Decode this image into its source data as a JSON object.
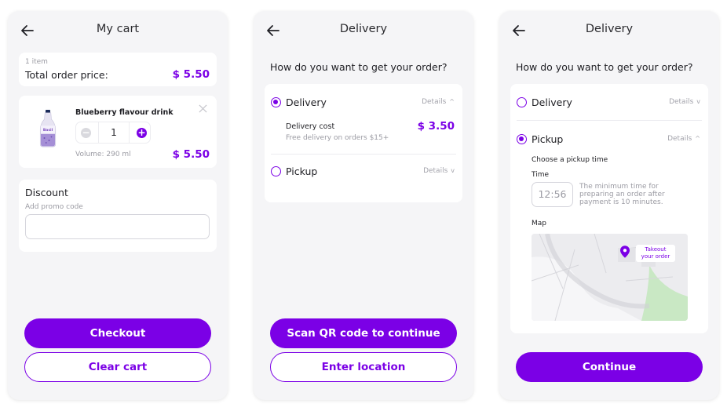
{
  "cart": {
    "title": "My cart",
    "items_count": "1 item",
    "total_label": "Total order price:",
    "total_value": "$ 5.50",
    "product": {
      "name": "Blueberry flavour drink",
      "quantity": "1",
      "volume": "Volume: 290 ml",
      "price": "$ 5.50"
    },
    "discount": {
      "title": "Discount",
      "promo_label": "Add promo code",
      "promo_value": ""
    },
    "checkout_label": "Checkout",
    "clear_label": "Clear cart"
  },
  "delivery": {
    "title": "Delivery",
    "question": "How do you want to get your order?",
    "option_delivery": "Delivery",
    "option_pickup": "Pickup",
    "details_label": "Details",
    "cost_label": "Delivery cost",
    "cost_value": "$ 3.50",
    "free_note": "Free delivery on orders $15+",
    "scan_label": "Scan QR code to continue",
    "enter_location_label": "Enter location"
  },
  "pickup": {
    "title": "Delivery",
    "question": "How do you want to get your order?",
    "option_delivery": "Delivery",
    "option_pickup": "Pickup",
    "details_label": "Details",
    "choose_time": "Choose a pickup time",
    "time_label": "Time",
    "time_value": "12:56",
    "time_note": "The minimum time for preparing an order after payment is 10 minutes.",
    "map_label": "Map",
    "map_pin_label": "Takeout your order",
    "continue_label": "Continue"
  },
  "colors": {
    "accent": "#7b00e6",
    "background": "#f5f5f7",
    "card": "#ffffff",
    "muted": "#9b9ba3",
    "map_green": "#c9e8c4"
  },
  "icons": [
    "back-arrow-icon",
    "close-icon",
    "minus-icon",
    "plus-icon",
    "chevron-up-icon",
    "chevron-down-icon",
    "map-pin-icon"
  ]
}
